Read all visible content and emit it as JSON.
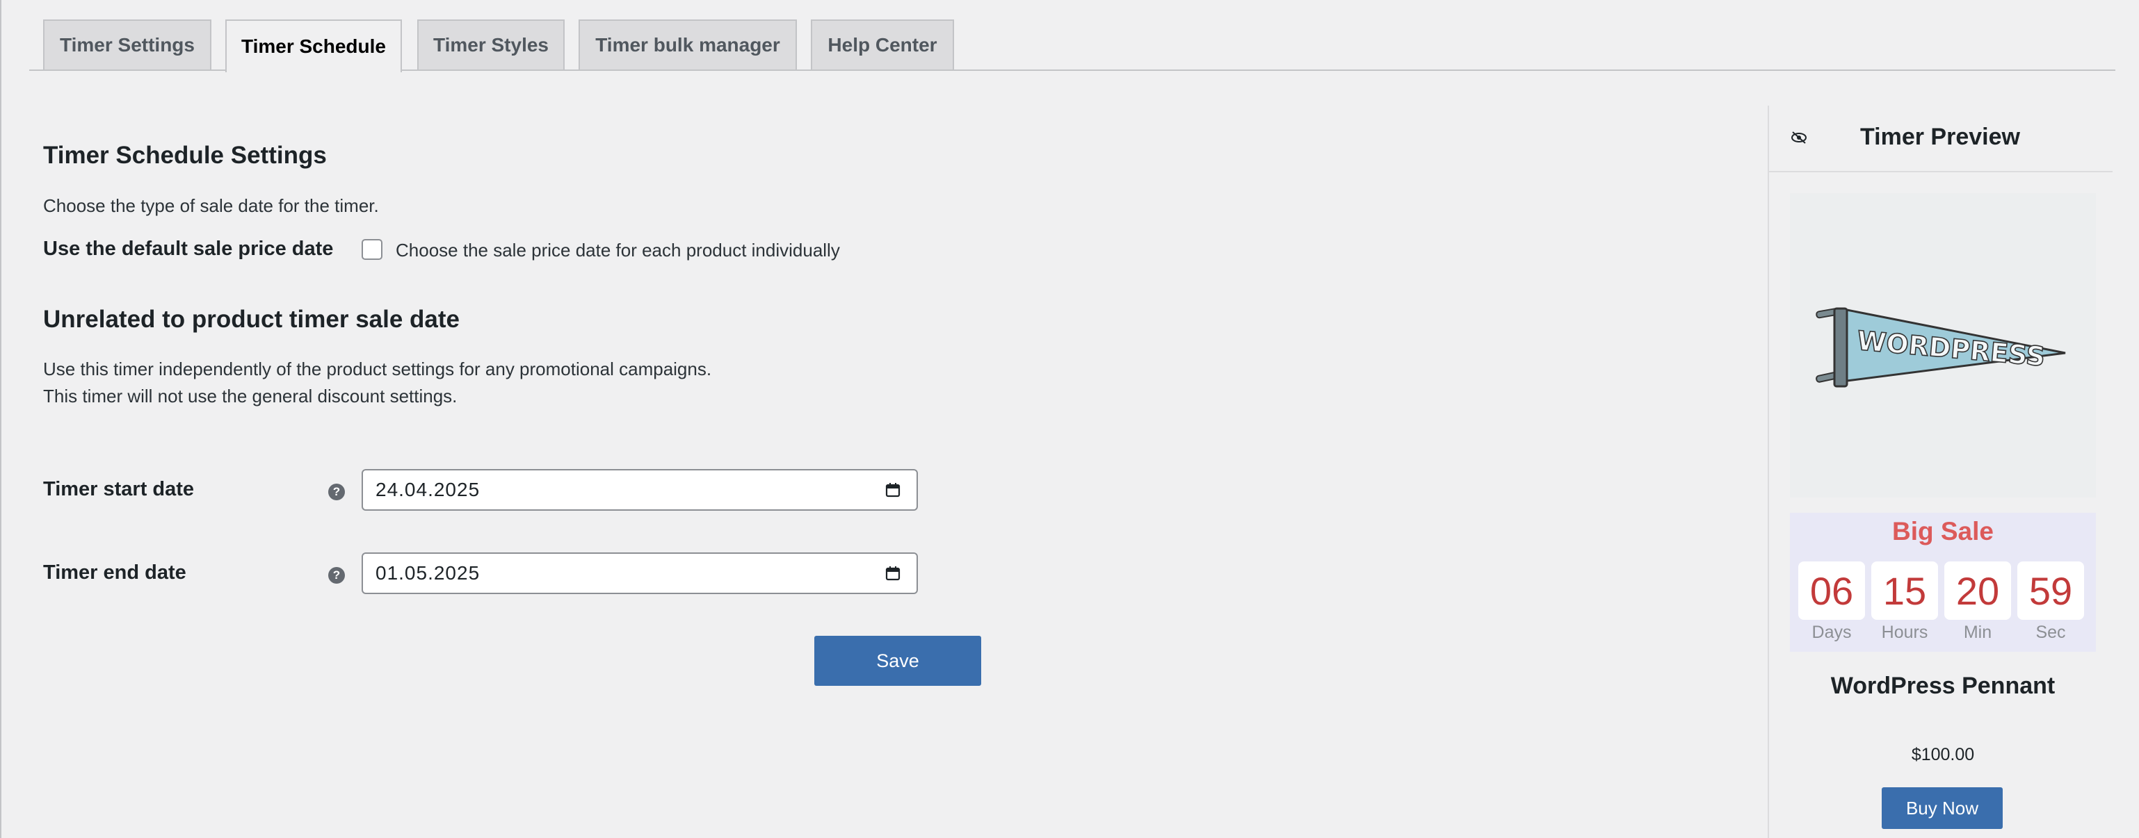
{
  "tabs": [
    {
      "label": "Timer Settings",
      "active": false
    },
    {
      "label": "Timer Schedule",
      "active": true
    },
    {
      "label": "Timer Styles",
      "active": false
    },
    {
      "label": "Timer bulk manager",
      "active": false
    },
    {
      "label": "Help Center",
      "active": false
    }
  ],
  "schedule": {
    "title": "Timer Schedule Settings",
    "description": "Choose the type of sale date for the timer.",
    "default_label": "Use the default sale price date",
    "individual_checkbox_label": "Choose the sale price date for each product individually",
    "individual_checked": false
  },
  "unrelated": {
    "title": "Unrelated to product timer sale date",
    "line1": "Use this timer independently of the product settings for any promotional campaigns.",
    "line2": "This timer will not use the general discount settings."
  },
  "dates": {
    "start_label": "Timer start date",
    "start_value": "24.04.2025",
    "end_label": "Timer end date",
    "end_value": "01.05.2025",
    "help_glyph": "?"
  },
  "save_label": "Save",
  "preview": {
    "title": "Timer Preview",
    "timer_title": "Big Sale",
    "units": [
      {
        "value": "06",
        "label": "Days"
      },
      {
        "value": "15",
        "label": "Hours"
      },
      {
        "value": "20",
        "label": "Min"
      },
      {
        "value": "59",
        "label": "Sec"
      }
    ],
    "product_name": "WordPress Pennant",
    "price": "$100.00",
    "buy_label": "Buy Now",
    "image_text": "WORDPRESS"
  },
  "colors": {
    "accent": "#3a6ead",
    "timer_red": "#c23a3a",
    "sale_title": "#dc5a5a"
  },
  "icons": [
    "eye-slash-icon",
    "help-icon",
    "calendar-icon"
  ]
}
